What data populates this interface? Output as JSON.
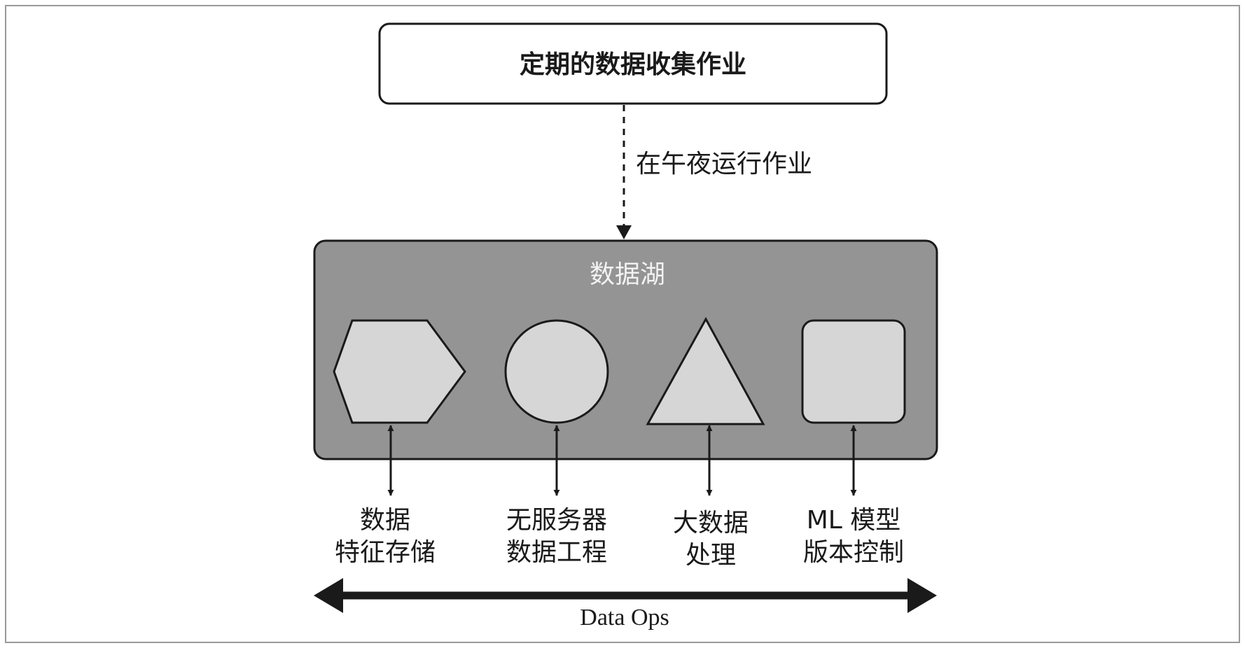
{
  "job_box": {
    "label": "定期的数据收集作业"
  },
  "trigger_arrow": {
    "label": "在午夜运行作业"
  },
  "data_lake": {
    "title": "数据湖"
  },
  "components": [
    {
      "shape": "hexagon",
      "icon": "hexagon-icon",
      "line1": "数据",
      "line2": "特征存储"
    },
    {
      "shape": "circle",
      "icon": "circle-icon",
      "line1": "无服务器",
      "line2": "数据工程"
    },
    {
      "shape": "triangle",
      "icon": "triangle-icon",
      "line1": "大数据",
      "line2": "处理"
    },
    {
      "shape": "square",
      "icon": "rounded-square-icon",
      "line1": "ML 模型",
      "line2": "版本控制"
    }
  ],
  "ops_bar": {
    "label": "Data Ops"
  },
  "colors": {
    "frame": "#9a9a9a",
    "stroke": "#1a1a1a",
    "lake_fill": "#949494",
    "shape_fill": "#d6d6d6",
    "lake_title": "#f2f2f2",
    "text": "#1a1a1a"
  }
}
